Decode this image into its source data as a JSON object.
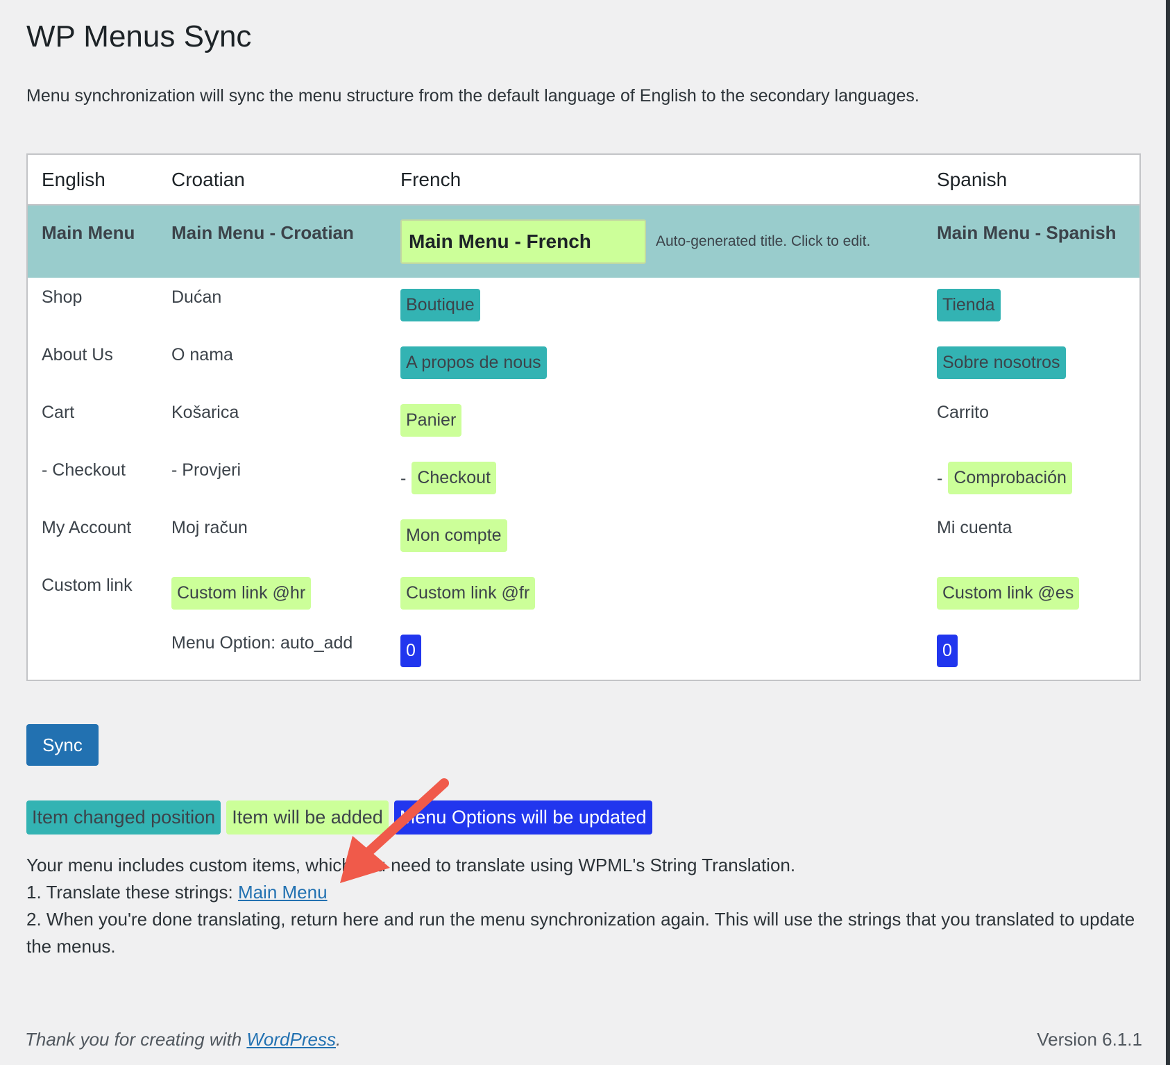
{
  "page": {
    "title": "WP Menus Sync",
    "intro": "Menu synchronization will sync the menu structure from the default language of English to the secondary languages."
  },
  "table": {
    "headers": {
      "en": "English",
      "hr": "Croatian",
      "fr": "French",
      "es": "Spanish"
    },
    "menu_row": {
      "en": "Main Menu",
      "hr": "Main Menu - Croatian",
      "fr_input": "Main Menu - French",
      "fr_hint": "Auto-generated title. Click to edit.",
      "es": "Main Menu - Spanish"
    },
    "rows": [
      {
        "en": "Shop",
        "hr": "Dućan",
        "fr": "Boutique",
        "es": "Tienda"
      },
      {
        "en": "About Us",
        "hr": "O nama",
        "fr": "A propos de nous",
        "es": "Sobre nosotros"
      },
      {
        "en": "Cart",
        "hr": "Košarica",
        "fr": "Panier",
        "es": "Carrito"
      },
      {
        "en": "- Checkout",
        "hr": "- Provjeri",
        "fr_dash": "-",
        "fr": "Checkout",
        "es_dash": "-",
        "es": "Comprobación"
      },
      {
        "en": "My Account",
        "hr": "Moj račun",
        "fr": "Mon compte",
        "es": "Mi cuenta"
      },
      {
        "en": "Custom link",
        "hr": "Custom link @hr",
        "fr": "Custom link @fr",
        "es": "Custom link @es"
      },
      {
        "en": "",
        "hr": "Menu Option: auto_add",
        "fr": "0",
        "es": "0"
      }
    ]
  },
  "sync_button": "Sync",
  "legend": {
    "changed_position": "Item changed position",
    "will_be_added": "Item will be added",
    "options_updated": "Menu Options will be updated"
  },
  "notice": {
    "line1": "Your menu includes custom items, which you need to translate using WPML's String Translation.",
    "line2_prefix": "1. Translate these strings: ",
    "line2_link": "Main Menu",
    "line3": "2. When you're done translating, return here and run the menu synchronization again. This will use the strings that you translated to update the menus."
  },
  "footer": {
    "thanks_prefix": "Thank you for creating with ",
    "thanks_link": "WordPress",
    "thanks_suffix": ".",
    "version": "Version 6.1.1"
  },
  "colors": {
    "changed_position": "#33b3b3",
    "will_be_added": "#ccff99",
    "options_updated": "#2136ee",
    "menu_row_bg": "#99cccc",
    "annotation_arrow": "#f05a4a",
    "primary_button": "#2271b1"
  },
  "icons": {
    "annotation": "red-arrow-icon"
  }
}
